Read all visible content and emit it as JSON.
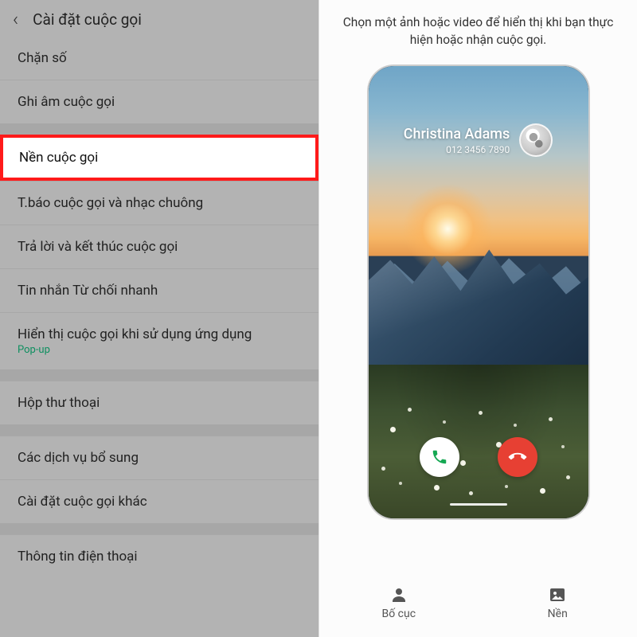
{
  "left": {
    "title": "Cài đặt cuộc gọi",
    "items": [
      {
        "label": "Chặn số"
      },
      {
        "label": "Ghi âm cuộc gọi"
      },
      {
        "label": "Nền cuộc gọi",
        "selected": true
      },
      {
        "label": "T.báo cuộc gọi và nhạc chuông"
      },
      {
        "label": "Trả lời và kết thúc cuộc gọi"
      },
      {
        "label": "Tin nhắn Từ chối nhanh"
      },
      {
        "label": "Hiển thị cuộc gọi khi sử dụng ứng dụng",
        "sub": "Pop-up"
      },
      {
        "label": "Hộp thư thoại"
      },
      {
        "label": "Các dịch vụ bổ sung"
      },
      {
        "label": "Cài đặt cuộc gọi khác"
      },
      {
        "label": "Thông tin điện thoại"
      }
    ]
  },
  "right": {
    "description": "Chọn một ảnh hoặc video để hiển thị khi bạn thực hiện hoặc nhận cuộc gọi.",
    "caller": {
      "name": "Christina Adams",
      "number": "012 3456 7890"
    },
    "tabs": {
      "layout": "Bố cục",
      "background": "Nền"
    }
  }
}
